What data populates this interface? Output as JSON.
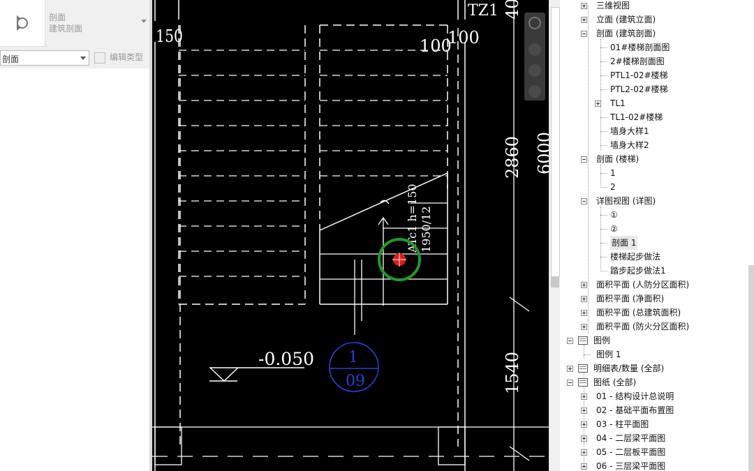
{
  "properties": {
    "type_family": "剖面",
    "type_name": "建筑剖面",
    "type_selector_value": "剖面",
    "edit_type_label": "编辑类型"
  },
  "drawing": {
    "dim_150": "150",
    "dim_100a": "100",
    "dim_100b": "100",
    "dim_2860": "2860",
    "dim_6000": "6000",
    "dim_1540": "1540",
    "dim_40": "40",
    "label_tz1": "TZ1",
    "stair_note_line1": "ATc1 h=150",
    "stair_note_line2": "1950/12",
    "elevation": "-0.050",
    "section_number": "1",
    "sheet_number": "09",
    "linework_color": "#ffffff",
    "marker_color": "#2a3fd6",
    "cursor_ring_color": "#1f9a2a",
    "cursor_color": "#e11a1a"
  },
  "browser": {
    "rows": [
      {
        "label": "三维视图",
        "expander": "plus",
        "icon": ""
      },
      {
        "label": "立面 (建筑立面)",
        "expander": "plus",
        "icon": ""
      },
      {
        "label": "剖面 (建筑剖面)",
        "expander": "minus",
        "icon": ""
      },
      {
        "label": "01#楼梯剖面图",
        "expander": "",
        "icon": ""
      },
      {
        "label": "2#楼梯剖面图",
        "expander": "",
        "icon": ""
      },
      {
        "label": "PTL1-02#楼梯",
        "expander": "",
        "icon": ""
      },
      {
        "label": "PTL2-02#楼梯",
        "expander": "",
        "icon": ""
      },
      {
        "label": "TL1",
        "expander": "plus",
        "icon": ""
      },
      {
        "label": "TL1-02#楼梯",
        "expander": "",
        "icon": ""
      },
      {
        "label": "墙身大样1",
        "expander": "",
        "icon": ""
      },
      {
        "label": "墙身大样2",
        "expander": "",
        "icon": ""
      },
      {
        "label": "剖面 (楼梯)",
        "expander": "minus",
        "icon": ""
      },
      {
        "label": "1",
        "expander": "",
        "icon": ""
      },
      {
        "label": "2",
        "expander": "",
        "icon": ""
      },
      {
        "label": "详图视图 (详图)",
        "expander": "minus",
        "icon": ""
      },
      {
        "label": "①",
        "expander": "",
        "icon": ""
      },
      {
        "label": "②",
        "expander": "",
        "icon": ""
      },
      {
        "label": "剖面 1",
        "expander": "",
        "icon": "",
        "selected": true
      },
      {
        "label": "楼梯起步做法",
        "expander": "",
        "icon": ""
      },
      {
        "label": "踏步起步做法1",
        "expander": "",
        "icon": ""
      },
      {
        "label": "面积平面 (人防分区面积)",
        "expander": "plus",
        "icon": ""
      },
      {
        "label": "面积平面 (净面积)",
        "expander": "plus",
        "icon": ""
      },
      {
        "label": "面积平面 (总建筑面积)",
        "expander": "plus",
        "icon": ""
      },
      {
        "label": "面积平面 (防火分区面积)",
        "expander": "plus",
        "icon": ""
      },
      {
        "label": "图例",
        "expander": "minus",
        "icon": "legend-icon"
      },
      {
        "label": "图例 1",
        "expander": "",
        "icon": ""
      },
      {
        "label": "明细表/数量 (全部)",
        "expander": "plus",
        "icon": "schedule-icon"
      },
      {
        "label": "图纸 (全部)",
        "expander": "minus",
        "icon": "sheet-icon"
      },
      {
        "label": "01 - 结构设计总说明",
        "expander": "plus",
        "icon": ""
      },
      {
        "label": "02 - 基础平面布置图",
        "expander": "plus",
        "icon": ""
      },
      {
        "label": "03 - 柱平面图",
        "expander": "plus",
        "icon": ""
      },
      {
        "label": "04 - 二层梁平面图",
        "expander": "plus",
        "icon": ""
      },
      {
        "label": "05 - 二层板平面图",
        "expander": "plus",
        "icon": ""
      },
      {
        "label": "06 - 三层梁平面图",
        "expander": "plus",
        "icon": ""
      }
    ]
  }
}
